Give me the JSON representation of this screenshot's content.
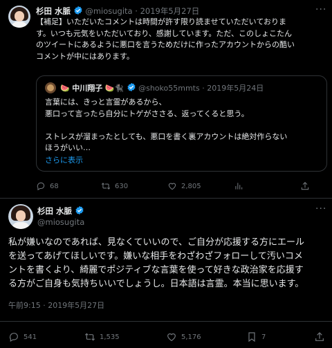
{
  "tweet1": {
    "author_name": "杉田 水脈",
    "handle": "@miosugita",
    "sep": "·",
    "date": "2019年5月27日",
    "text": "【補足】いただいたコメントは時間が許す限り読ませていただいておりま\nす。いつも元気をいただいており、感謝しています。ただ、このしょこたん\nのツイートにあるように悪口を言うためだけに作ったアカウントからの酷い\nコメントが中にはあります。",
    "quote": {
      "prefix_emoji": "🍉",
      "author_name": "中川翔子",
      "suffix_emoji": "🍉🐈‍⬛",
      "handle": "@shoko55mmts",
      "sep": "·",
      "date": "2019年5月24日",
      "text": "言葉には、きっと言霊があるから、\n悪口って言ったら自分にトゲがささる、返ってくると思う。\n\nストレスが溜まったとしても、悪口を書く裏アカウントは絶対作らない\nほうがいい…",
      "show_more": "さらに表示"
    },
    "stats": {
      "replies": "68",
      "retweets": "630",
      "likes": "2,805"
    }
  },
  "tweet2": {
    "author_name": "杉田 水脈",
    "handle": "@miosugita",
    "text": "私が嫌いなのであれば、見なくていいので、ご自分が応援する方にエール\nを送ってあげてほしいです。嫌いな相手をわざわざフォローして汚いコメ\nントを書くより、綺麗でポジティブな言葉を使って好きな政治家を応援す\nる方がご自身も気持ちいいでしょうし。日本語は言霊。本当に思います。",
    "timestamp": "午前9:15 · 2019年5月27日",
    "stats": {
      "replies": "541",
      "retweets": "1,535",
      "likes": "5,176",
      "views": "7"
    }
  },
  "colors": {
    "accent": "#1d9bf0",
    "muted": "#71767b",
    "text": "#e7e9ea",
    "background": "#000000",
    "border": "#2f3336"
  }
}
